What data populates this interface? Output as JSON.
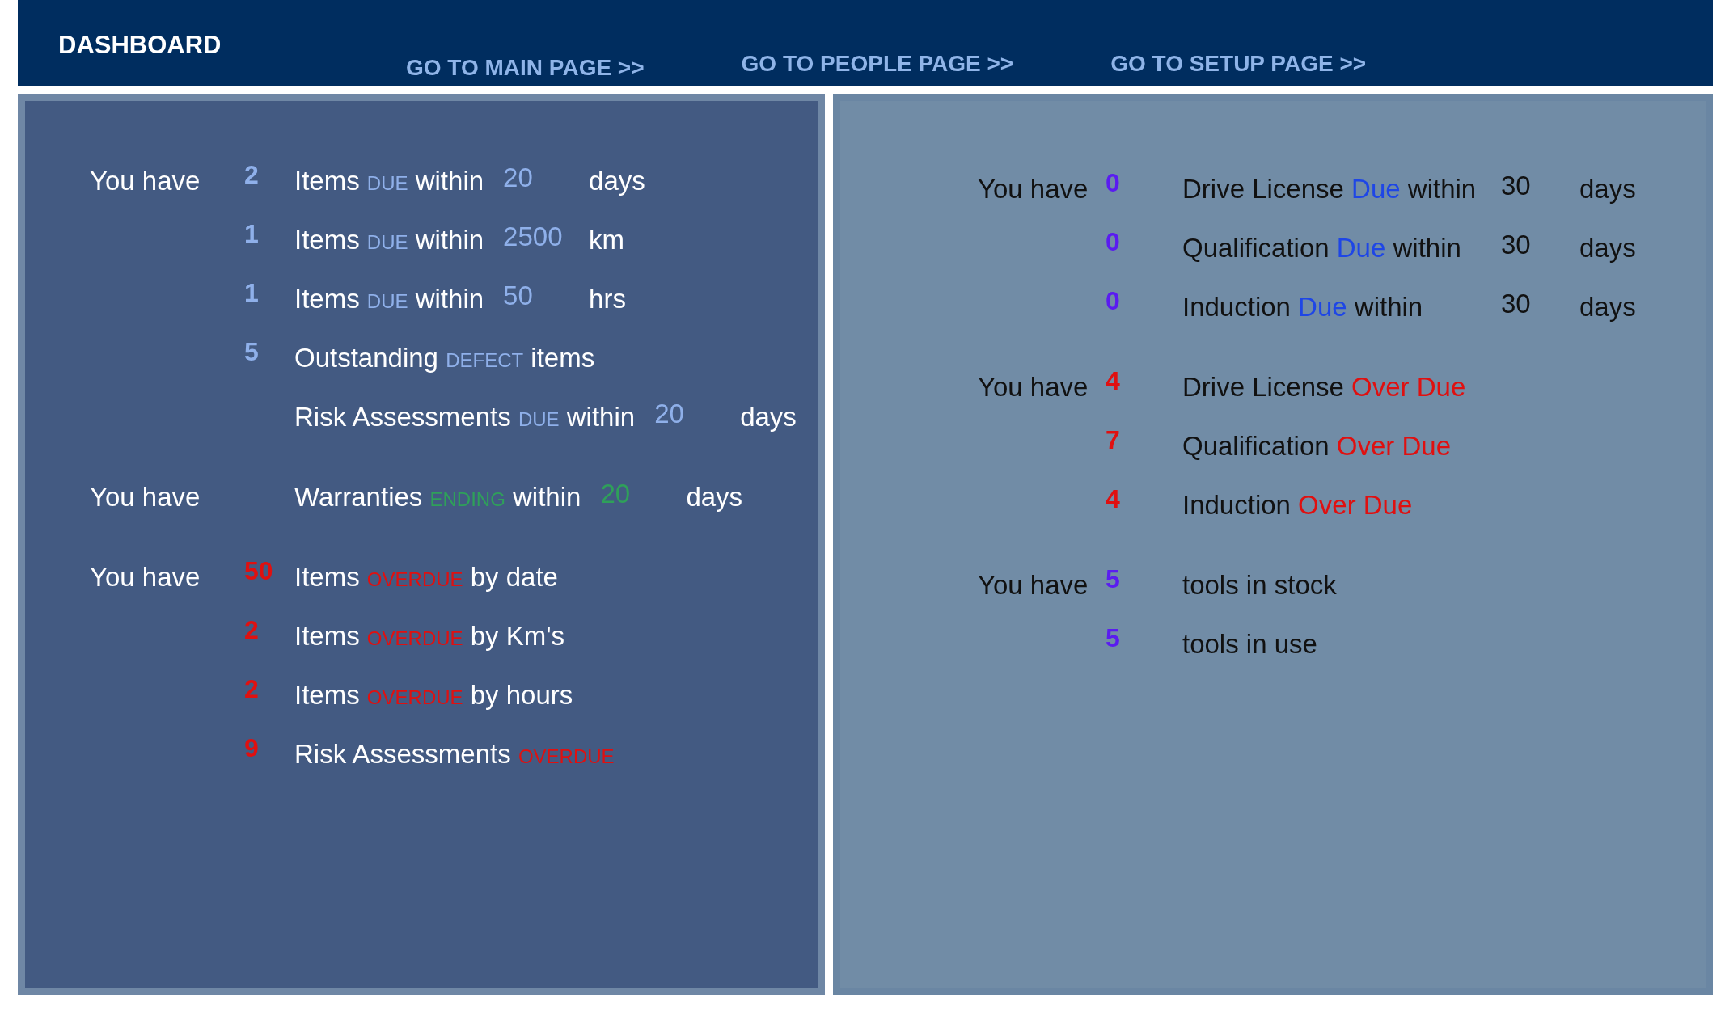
{
  "header": {
    "title": "DASHBOARD",
    "links": [
      "GO TO MAIN PAGE >>",
      "GO TO PEOPLE PAGE >>",
      "GO TO SETUP PAGE >>"
    ]
  },
  "equipment_panel": {
    "groups": [
      {
        "rows": [
          {
            "kind": "due",
            "prefix": "You have",
            "count": "2",
            "lead": "Items",
            "keyword": "DUE",
            "trail": "within",
            "amount": "20",
            "unit": "days"
          },
          {
            "kind": "due",
            "count": "1",
            "lead": "Items",
            "keyword": "DUE",
            "trail": "within",
            "amount": "2500",
            "unit": "km"
          },
          {
            "kind": "due",
            "count": "1",
            "lead": "Items",
            "keyword": "DUE",
            "trail": "within",
            "amount": "50",
            "unit": "hrs"
          },
          {
            "kind": "due",
            "count": "5",
            "lead": "Outstanding",
            "keyword": "DEFECT",
            "trail": "items"
          },
          {
            "kind": "due",
            "lead": "Risk Assessments",
            "keyword": "DUE",
            "trail": "within",
            "amount": "20",
            "unit": "days"
          }
        ]
      },
      {
        "rows": [
          {
            "kind": "ending",
            "prefix": "You have",
            "lead": "Warranties",
            "keyword": "ENDING",
            "trail": "within",
            "amount": "20",
            "unit": "days"
          }
        ]
      },
      {
        "rows": [
          {
            "kind": "overdue",
            "prefix": "You have",
            "count": "50",
            "lead": "Items",
            "keyword": "OVERDUE",
            "trail": "by date"
          },
          {
            "kind": "overdue",
            "count": "2",
            "lead": "Items",
            "keyword": "OVERDUE",
            "trail": "by Km's"
          },
          {
            "kind": "overdue",
            "count": "2",
            "lead": "Items",
            "keyword": "OVERDUE",
            "trail": "by hours"
          },
          {
            "kind": "overdue",
            "count": "9",
            "lead": "Risk Assessments",
            "keyword": "OVERDUE"
          }
        ]
      }
    ]
  },
  "people_panel": {
    "groups": [
      {
        "rows": [
          {
            "kind": "due",
            "prefix": "You have",
            "count": "0",
            "lead": "Drive License",
            "keyword": "Due",
            "trail": "within",
            "amount": "30",
            "unit": "days"
          },
          {
            "kind": "due",
            "count": "0",
            "lead": "Qualification",
            "keyword": "Due",
            "trail": "within",
            "amount": "30",
            "unit": "days"
          },
          {
            "kind": "due",
            "count": "0",
            "lead": "Induction",
            "keyword": "Due",
            "trail": "within",
            "amount": "30",
            "unit": "days"
          }
        ]
      },
      {
        "rows": [
          {
            "kind": "overdue",
            "prefix": "You have",
            "count": "4",
            "lead": "Drive License",
            "keyword": "Over Due"
          },
          {
            "kind": "overdue",
            "count": "7",
            "lead": "Qualification",
            "keyword": "Over Due"
          },
          {
            "kind": "overdue",
            "count": "4",
            "lead": "Induction",
            "keyword": "Over Due"
          }
        ]
      },
      {
        "rows": [
          {
            "kind": "stock",
            "prefix": "You have",
            "count": "5",
            "lead": "tools in stock"
          },
          {
            "kind": "stock",
            "count": "5",
            "lead": "tools in use"
          }
        ]
      }
    ]
  }
}
